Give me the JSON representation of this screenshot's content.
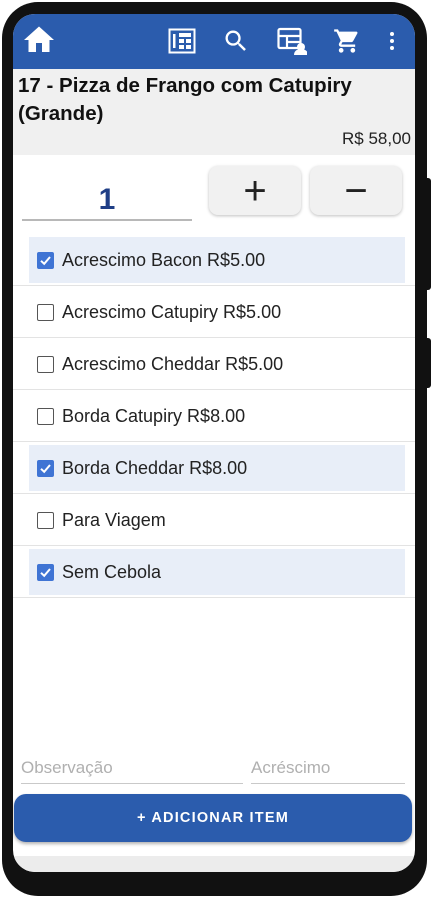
{
  "colors": {
    "app_bar": "#2b5cad",
    "accent_checkbox": "#3f74d4",
    "checked_row": "#e8eef8",
    "quantity_text": "#1f3e86"
  },
  "app_bar": {
    "icons": [
      "home-icon",
      "calculator-icon",
      "search-icon",
      "table-icon",
      "cart-icon",
      "more-vertical-icon"
    ]
  },
  "product": {
    "title": "17 - Pizza de Frango com Catupiry (Grande)",
    "price": "R$ 58,00"
  },
  "quantity": {
    "value": "1",
    "plus_label": "+",
    "minus_label": "−"
  },
  "options": [
    {
      "label": "Acrescimo Bacon R$5.00",
      "checked": true
    },
    {
      "label": "Acrescimo Catupiry R$5.00",
      "checked": false
    },
    {
      "label": "Acrescimo Cheddar R$5.00",
      "checked": false
    },
    {
      "label": "Borda Catupiry R$8.00",
      "checked": false
    },
    {
      "label": "Borda Cheddar R$8.00",
      "checked": true
    },
    {
      "label": "Para Viagem",
      "checked": false
    },
    {
      "label": "Sem Cebola",
      "checked": true
    }
  ],
  "footer": {
    "observacao_placeholder": "Observação",
    "acrescimo_placeholder": "Acréscimo",
    "add_button_label": "+ ADICIONAR ITEM"
  }
}
